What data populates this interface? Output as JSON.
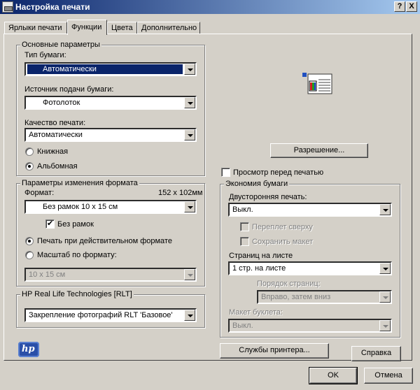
{
  "window": {
    "title": "Настройка печати",
    "help_btn": "?",
    "close_btn": "X"
  },
  "tabs": [
    {
      "label": "Ярлыки печати"
    },
    {
      "label": "Функции"
    },
    {
      "label": "Цвета"
    },
    {
      "label": "Дополнительно"
    }
  ],
  "basic": {
    "title": "Основные параметры",
    "paper_type_label": "Тип бумаги:",
    "paper_type_value": "Автоматически",
    "source_label": "Источник подачи бумаги:",
    "source_value": "Фотолоток",
    "quality_label": "Качество печати:",
    "quality_value": "Автоматически",
    "portrait": "Книжная",
    "landscape": "Альбомная",
    "orientation_selected": "landscape"
  },
  "resize": {
    "title": "Параметры изменения формата",
    "format_label": "Формат:",
    "format_size": "152 x 102мм",
    "format_value": "Без рамок 10 x 15 см",
    "borderless_label": "Без рамок",
    "actual_size_label": "Печать при действительном формате",
    "scale_label": "Масштаб по формату:",
    "scale_value": "10 x 15 см"
  },
  "rlt": {
    "title": "HP Real Life Technologies [RLT]",
    "value": "Закрепление фотографий RLT 'Базовое'"
  },
  "right": {
    "resolution_button": "Разрешение...",
    "preview_label": "Просмотр перед печатью"
  },
  "economy": {
    "title": "Экономия бумаги",
    "duplex_label": "Двусторонняя печать:",
    "duplex_value": "Выкл.",
    "flip_top_label": "Переплет сверху",
    "keep_layout_label": "Сохранить макет",
    "pages_per_sheet_label": "Страниц на листе",
    "pages_per_sheet_value": "1 стр. на листе",
    "page_order_label": "Порядок страниц:",
    "page_order_value": "Вправо, затем вниз",
    "booklet_label": "Макет буклета:",
    "booklet_value": "Выкл."
  },
  "bottom": {
    "logo_text": "hp",
    "services_button": "Службы принтера...",
    "help_button": "Справка",
    "ok_button": "OK",
    "cancel_button": "Отмена"
  },
  "colors": {
    "titlebar_start": "#0a246a",
    "titlebar_end": "#a6caf0",
    "dialog_bg": "#d4d0c8",
    "highlight": "#0a246a"
  }
}
